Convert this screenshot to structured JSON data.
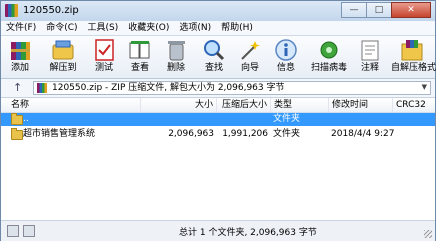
{
  "window": {
    "title": "120550.zip",
    "min": "—",
    "max": "□",
    "close": "✕"
  },
  "menu": [
    "文件(F)",
    "命令(C)",
    "工具(S)",
    "收藏夹(O)",
    "选项(N)",
    "帮助(H)"
  ],
  "toolbar": [
    {
      "label": "添加",
      "icon": "add-archive-icon"
    },
    {
      "label": "解压到",
      "icon": "extract-to-icon"
    },
    {
      "label": "测试",
      "icon": "test-icon"
    },
    {
      "label": "查看",
      "icon": "view-icon"
    },
    {
      "label": "删除",
      "icon": "delete-icon"
    },
    {
      "label": "查找",
      "icon": "find-icon"
    },
    {
      "label": "向导",
      "icon": "wizard-icon"
    },
    {
      "label": "信息",
      "icon": "info-icon"
    },
    {
      "label": "扫描病毒",
      "icon": "virus-scan-icon"
    },
    {
      "label": "注释",
      "icon": "comment-icon"
    },
    {
      "label": "自解压格式",
      "icon": "sfx-icon"
    }
  ],
  "address": {
    "path": "120550.zip - ZIP 压缩文件, 解包大小为 2,096,963 字节"
  },
  "columns": [
    "名称",
    "大小",
    "压缩后大小",
    "类型",
    "修改时间",
    "CRC32"
  ],
  "rows": [
    {
      "name": "..",
      "size": "",
      "packed": "",
      "type": "文件夹",
      "modified": "",
      "crc": ""
    },
    {
      "name": "超市销售管理系统",
      "size": "2,096,963",
      "packed": "1,991,206",
      "type": "文件夹",
      "modified": "2018/4/4 9:27",
      "crc": ""
    }
  ],
  "status": {
    "text": "总计 1 个文件夹, 2,096,963 字节"
  }
}
